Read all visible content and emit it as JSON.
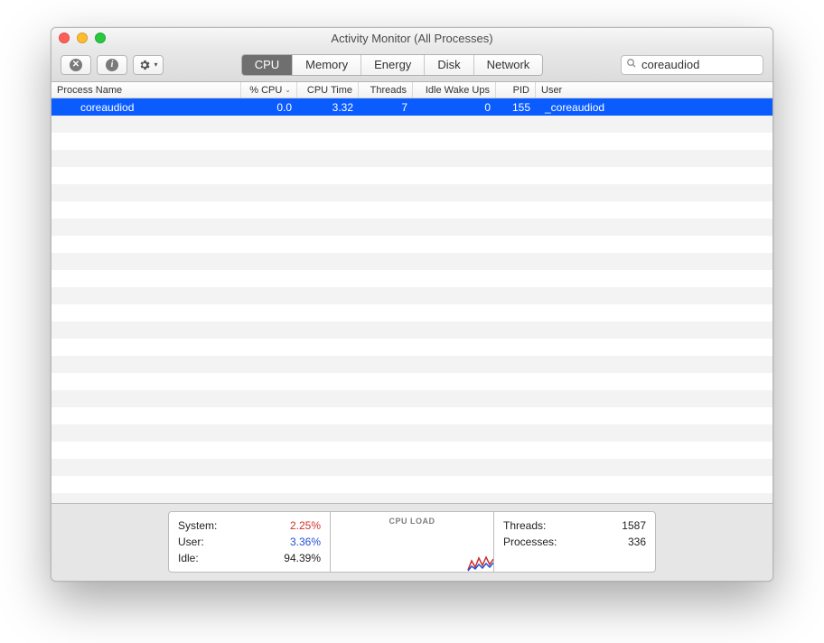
{
  "window": {
    "title": "Activity Monitor (All Processes)"
  },
  "tabs": [
    "CPU",
    "Memory",
    "Energy",
    "Disk",
    "Network"
  ],
  "active_tab": "CPU",
  "search": {
    "value": "coreaudiod"
  },
  "columns": [
    "Process Name",
    "% CPU",
    "CPU Time",
    "Threads",
    "Idle Wake Ups",
    "PID",
    "User"
  ],
  "sort_column": "% CPU",
  "rows": [
    {
      "name": "coreaudiod",
      "pct_cpu": "0.0",
      "cpu_time": "3.32",
      "threads": "7",
      "idle_wake_ups": "0",
      "pid": "155",
      "user": "_coreaudiod",
      "selected": true
    }
  ],
  "footer": {
    "left": [
      {
        "label": "System:",
        "value": "2.25%",
        "color": "#d3302a"
      },
      {
        "label": "User:",
        "value": "3.36%",
        "color": "#2350d6"
      },
      {
        "label": "Idle:",
        "value": "94.39%"
      }
    ],
    "center_heading": "CPU LOAD",
    "right": [
      {
        "label": "Threads:",
        "value": "1587"
      },
      {
        "label": "Processes:",
        "value": "336"
      }
    ]
  }
}
